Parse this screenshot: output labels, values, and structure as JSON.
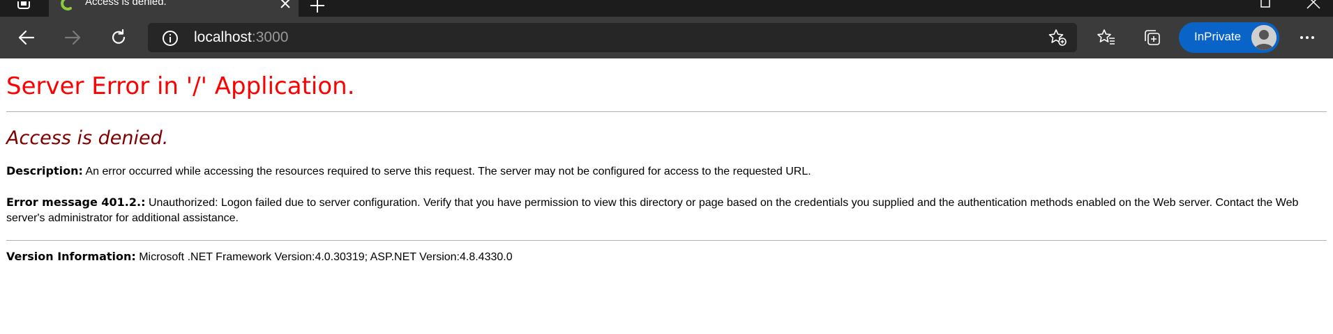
{
  "browser": {
    "tab_title": "Access is denied.",
    "url_host": "localhost",
    "url_port": ":3000",
    "inprivate_label": "InPrivate",
    "accent_color": "#0a64c8"
  },
  "page": {
    "title": "Server Error in '/' Application.",
    "error_heading": "Access is denied.",
    "description_label": "Description:",
    "description_text": " An error occurred while accessing the resources required to serve this request. The server may not be configured for access to the requested URL.",
    "error_label": "Error message 401.2.:",
    "error_text": " Unauthorized: Logon failed due to server configuration.  Verify that you have permission to view this directory or page based on the credentials you supplied and the authentication methods enabled on the Web server.  Contact the Web server's administrator for additional assistance.",
    "version_label": "Version Information:",
    "version_text": " Microsoft .NET Framework Version:4.0.30319; ASP.NET Version:4.8.4330.0",
    "title_color": "#ff0000",
    "heading_color": "#800000"
  },
  "icons": {
    "back": "arrow-left-icon",
    "forward": "arrow-right-icon",
    "refresh": "refresh-icon",
    "info": "info-icon",
    "add_favorite": "star-add-icon",
    "favorites": "favorites-icon",
    "collections": "collections-icon",
    "more": "more-icon"
  }
}
